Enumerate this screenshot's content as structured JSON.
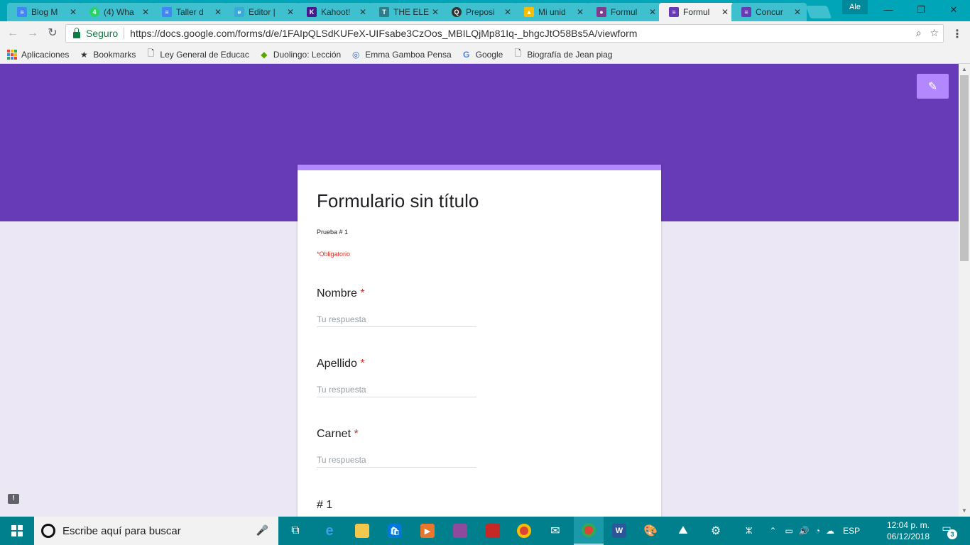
{
  "browser": {
    "tabs": [
      {
        "label": "Blog M",
        "icon": "docs-icon",
        "color": "#4285f4"
      },
      {
        "label": "(4) Wha",
        "icon": "whatsapp-icon",
        "color": "#25d366"
      },
      {
        "label": "Taller d",
        "icon": "docs-icon",
        "color": "#4285f4"
      },
      {
        "label": "Editor |",
        "icon": "editor-icon",
        "color": "#3aa8d8"
      },
      {
        "label": "Kahoot!",
        "icon": "kahoot-icon",
        "color": "#46178f"
      },
      {
        "label": "THE ELE",
        "icon": "tshirt-icon",
        "color": "#2e7d88"
      },
      {
        "label": "Preposi",
        "icon": "quiz-icon",
        "color": "#333333"
      },
      {
        "label": "Mi unid",
        "icon": "drive-icon",
        "color": "#fbbc04"
      },
      {
        "label": "Formul",
        "icon": "contacts-icon",
        "color": "#7e3c8f"
      },
      {
        "label": "Formul",
        "icon": "forms-icon",
        "color": "#673ab7",
        "active": true
      },
      {
        "label": "Concur",
        "icon": "forms-icon",
        "color": "#673ab7"
      }
    ],
    "profile_name": "Ale",
    "secure_label": "Seguro",
    "url": "https://docs.google.com/forms/d/e/1FAIpQLSdKUFeX-UIFsabe3CzOos_MBILQjMp81Iq-_bhgcJtO58Bs5A/viewform",
    "bookmarks": [
      {
        "label": "Aplicaciones",
        "icon": "apps-grid-icon"
      },
      {
        "label": "Bookmarks",
        "icon": "star-icon"
      },
      {
        "label": "Ley General de Educac",
        "icon": "page-icon"
      },
      {
        "label": "Duolingo: Lección",
        "icon": "duolingo-icon"
      },
      {
        "label": "Emma Gamboa Pensa",
        "icon": "globe-icon"
      },
      {
        "label": "Google",
        "icon": "google-icon"
      },
      {
        "label": "Biografía de Jean piag",
        "icon": "page-icon"
      }
    ]
  },
  "form": {
    "title": "Formulario sin título",
    "description": "Prueba # 1",
    "required_note": "*Obligatorio",
    "questions": [
      {
        "label": "Nombre",
        "required_mark": "*",
        "placeholder": "Tu respuesta"
      },
      {
        "label": "Apellido",
        "required_mark": "*",
        "placeholder": "Tu respuesta"
      },
      {
        "label": "Carnet",
        "required_mark": "*",
        "placeholder": "Tu respuesta"
      },
      {
        "label": "# 1"
      }
    ],
    "colors": {
      "banner": "#673ab7",
      "accent": "#b388ff",
      "required": "#d93025",
      "background": "#ece7f5"
    }
  },
  "taskbar": {
    "search_placeholder": "Escribe aquí para buscar",
    "language": "ESP",
    "time": "12:04 p. m.",
    "date": "06/12/2018",
    "notification_count": "3"
  }
}
